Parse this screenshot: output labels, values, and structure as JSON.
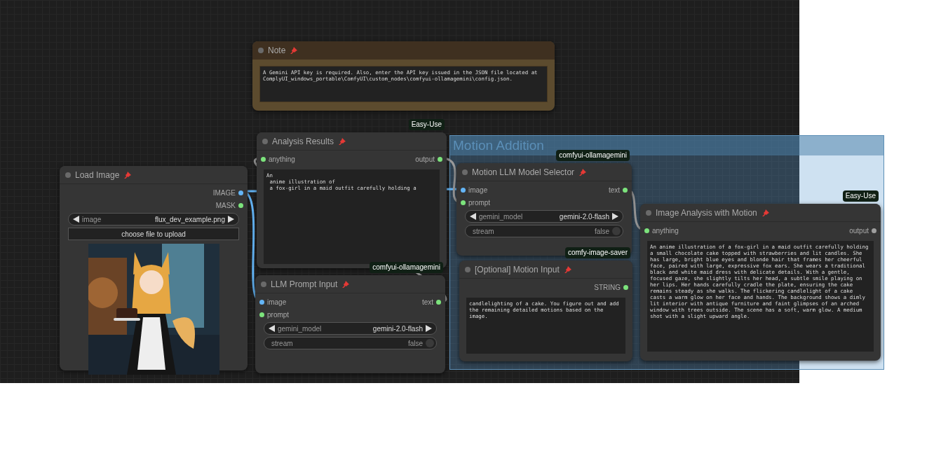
{
  "group": {
    "title": "Motion Addition"
  },
  "nodes": [
    {
      "title": "Note",
      "pinned": true,
      "kind": "note",
      "text": "A Gemini API key is required. Also, enter the API key issued in the JSON file located at ComplyUI_windows_portable\\ComfyUI\\custom_nodes\\comfyui-ollamagemini\\config.json."
    },
    {
      "title": "Analysis Results",
      "pinned": true,
      "kind": "node",
      "badge": "Easy-Use",
      "inputs": [
        {
          "label": "anything",
          "color": "#7ce37c"
        }
      ],
      "outputs": [
        {
          "label": "output",
          "color": "#7ce37c"
        }
      ],
      "text": "An\n anime illustration of\n a fox-girl in a maid outfit carefully holding a"
    },
    {
      "title": "Load Image",
      "pinned": true,
      "kind": "node",
      "outputs": [
        {
          "label": "IMAGE",
          "color": "#64b5f6"
        },
        {
          "label": "MASK",
          "color": "#7ce37c"
        }
      ],
      "widgets": [
        {
          "kind": "combo",
          "label": "image",
          "value": "flux_dev_example.png"
        },
        {
          "kind": "button",
          "label": "choose file to upload"
        }
      ]
    },
    {
      "title": "LLM Prompt Input",
      "pinned": true,
      "kind": "node",
      "badge": "comfyui-ollamagemini",
      "inputs": [
        {
          "label": "image",
          "color": "#64b5f6"
        },
        {
          "label": "prompt",
          "color": "#7ce37c"
        }
      ],
      "outputs": [
        {
          "label": "text",
          "color": "#7ce37c"
        }
      ],
      "widgets": [
        {
          "kind": "combo",
          "label": "gemini_model",
          "value": "gemini-2.0-flash"
        },
        {
          "kind": "toggle",
          "label": "stream",
          "value": "false",
          "on": false
        }
      ]
    },
    {
      "title": "Motion LLM Model Selector",
      "pinned": true,
      "kind": "node",
      "badge": "comfyui-ollamagemini",
      "inputs": [
        {
          "label": "image",
          "color": "#64b5f6"
        },
        {
          "label": "prompt",
          "color": "#7ce37c"
        }
      ],
      "outputs": [
        {
          "label": "text",
          "color": "#7ce37c"
        }
      ],
      "widgets": [
        {
          "kind": "combo",
          "label": "gemini_model",
          "value": "gemini-2.0-flash"
        },
        {
          "kind": "toggle",
          "label": "stream",
          "value": "false",
          "on": false
        }
      ]
    },
    {
      "title": "[Optional] Motion Input",
      "pinned": true,
      "kind": "node",
      "badge": "comfy-image-saver",
      "outputs": [
        {
          "label": "STRING",
          "color": "#7ce37c"
        }
      ],
      "text": "candlelighting of a cake. You figure out and add the remaining detailed motions based on the image."
    },
    {
      "title": "Image Analysis with Motion",
      "pinned": true,
      "kind": "node",
      "badge": "Easy-Use",
      "inputs": [
        {
          "label": "anything",
          "color": "#7ce37c"
        }
      ],
      "outputs": [
        {
          "label": "output",
          "color": "#9e9e9e"
        }
      ],
      "text": "An anime illustration of a fox-girl in a maid outfit carefully holding a small chocolate cake topped with strawberries and lit candles. She has large, bright blue eyes and blonde hair that frames her cheerful face, paired with large, expressive fox ears. She wears a traditional black and white maid dress with delicate details. With a gentle, focused gaze, she slightly tilts her head, a subtle smile playing on her lips. Her hands carefully cradle the plate, ensuring the cake remains steady as she walks. The flickering candlelight of a cake casts a warm glow on her face and hands. The background shows a dimly lit interior with antique furniture and faint glimpses of an arched window with trees outside. The scene has a soft, warm glow. A medium shot with a slight upward angle."
    }
  ]
}
